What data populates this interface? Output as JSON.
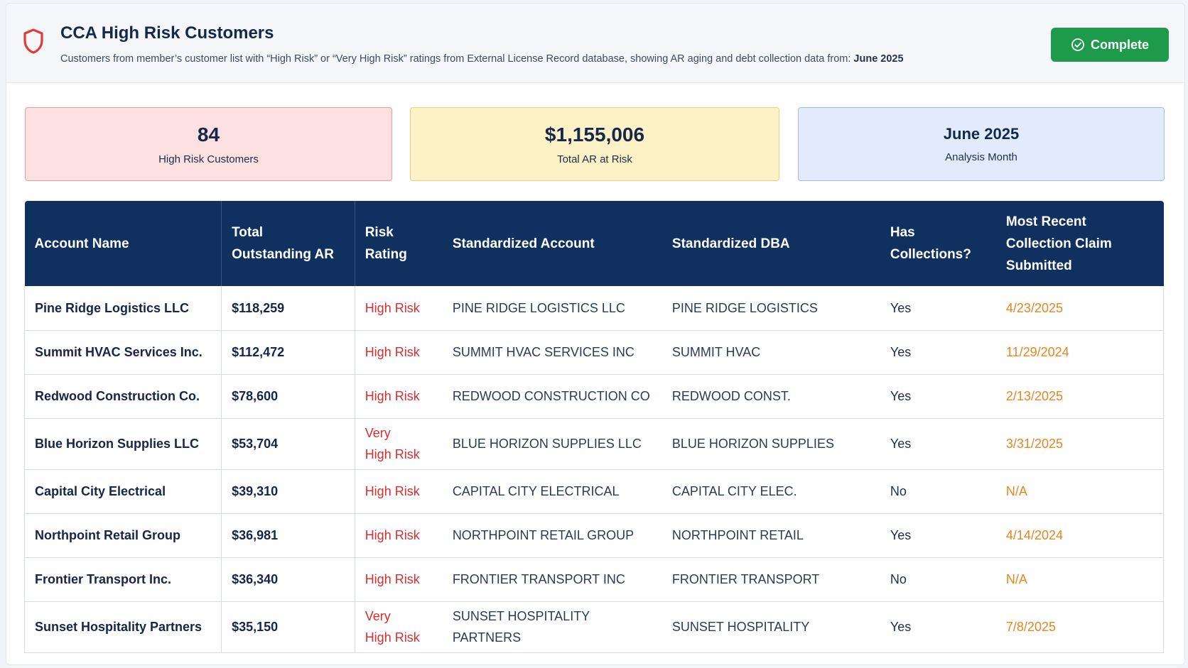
{
  "header": {
    "title": "CCA High Risk Customers",
    "subtitle_main": "Customers from member’s customer list with “High Risk” or “Very High Risk” ratings from External License Record database, showing AR aging and debt collection data from:",
    "subtitle_month": "June 2025",
    "complete_label": "Complete"
  },
  "summary": {
    "customers_value": "84",
    "customers_label": "High Risk Customers",
    "ar_value": "$1,155,006",
    "ar_label": "Total AR at Risk",
    "month_value": "June 2025",
    "month_label": "Analysis Month"
  },
  "table": {
    "headers": {
      "account": "Account Name",
      "ar_line1": "Total",
      "ar_line2": "Outstanding AR",
      "risk_line1": "Risk",
      "risk_line2": "Rating",
      "std_account": "Standardized Account",
      "std_dba": "Standardized DBA",
      "coll_line1": "Has",
      "coll_line2": "Collections?",
      "recent_line1": "Most Recent",
      "recent_line2": "Collection Claim",
      "recent_line3": "Submitted"
    },
    "rows": [
      {
        "account": "Pine Ridge Logistics LLC",
        "ar": "$118,259",
        "risk1": "High Risk",
        "risk2": "",
        "std_account": "PINE RIDGE LOGISTICS LLC",
        "std_dba": "PINE RIDGE LOGISTICS",
        "collections": "Yes",
        "recent": "4/23/2025"
      },
      {
        "account": "Summit HVAC Services Inc.",
        "ar": "$112,472",
        "risk1": "High Risk",
        "risk2": "",
        "std_account": "SUMMIT HVAC SERVICES INC",
        "std_dba": "SUMMIT HVAC",
        "collections": "Yes",
        "recent": "11/29/2024"
      },
      {
        "account": "Redwood Construction Co.",
        "ar": "$78,600",
        "risk1": "High Risk",
        "risk2": "",
        "std_account": "REDWOOD CONSTRUCTION CO",
        "std_dba": "REDWOOD CONST.",
        "collections": "Yes",
        "recent": "2/13/2025"
      },
      {
        "account": "Blue Horizon Supplies LLC",
        "ar": "$53,704",
        "risk1": "Very",
        "risk2": "High Risk",
        "std_account": "BLUE HORIZON SUPPLIES LLC",
        "std_dba": "BLUE HORIZON SUPPLIES",
        "collections": "Yes",
        "recent": "3/31/2025"
      },
      {
        "account": "Capital City Electrical",
        "ar": "$39,310",
        "risk1": "High Risk",
        "risk2": "",
        "std_account": "CAPITAL CITY ELECTRICAL",
        "std_dba": "CAPITAL CITY ELEC.",
        "collections": "No",
        "recent": "N/A"
      },
      {
        "account": "Northpoint Retail Group",
        "ar": "$36,981",
        "risk1": "High Risk",
        "risk2": "",
        "std_account": "NORTHPOINT RETAIL GROUP",
        "std_dba": "NORTHPOINT RETAIL",
        "collections": "Yes",
        "recent": "4/14/2024"
      },
      {
        "account": "Frontier Transport Inc.",
        "ar": "$36,340",
        "risk1": "High Risk",
        "risk2": "",
        "std_account": "FRONTIER TRANSPORT INC",
        "std_dba": "FRONTIER TRANSPORT",
        "collections": "No",
        "recent": "N/A"
      },
      {
        "account": "Sunset Hospitality Partners",
        "ar": "$35,150",
        "risk1": "Very",
        "risk2": "High Risk",
        "std_account": "SUNSET HOSPITALITY PARTNERS",
        "std_dba": "SUNSET HOSPITALITY",
        "collections": "Yes",
        "recent": "7/8/2025"
      }
    ]
  },
  "colors": {
    "header_bg": "#10305f",
    "risk_text": "#d92e2e",
    "date_text": "#e48622",
    "complete_bg": "#1e9a4b"
  },
  "icons": {
    "title_icon": "shield-icon",
    "complete_icon": "check-circle-icon"
  }
}
